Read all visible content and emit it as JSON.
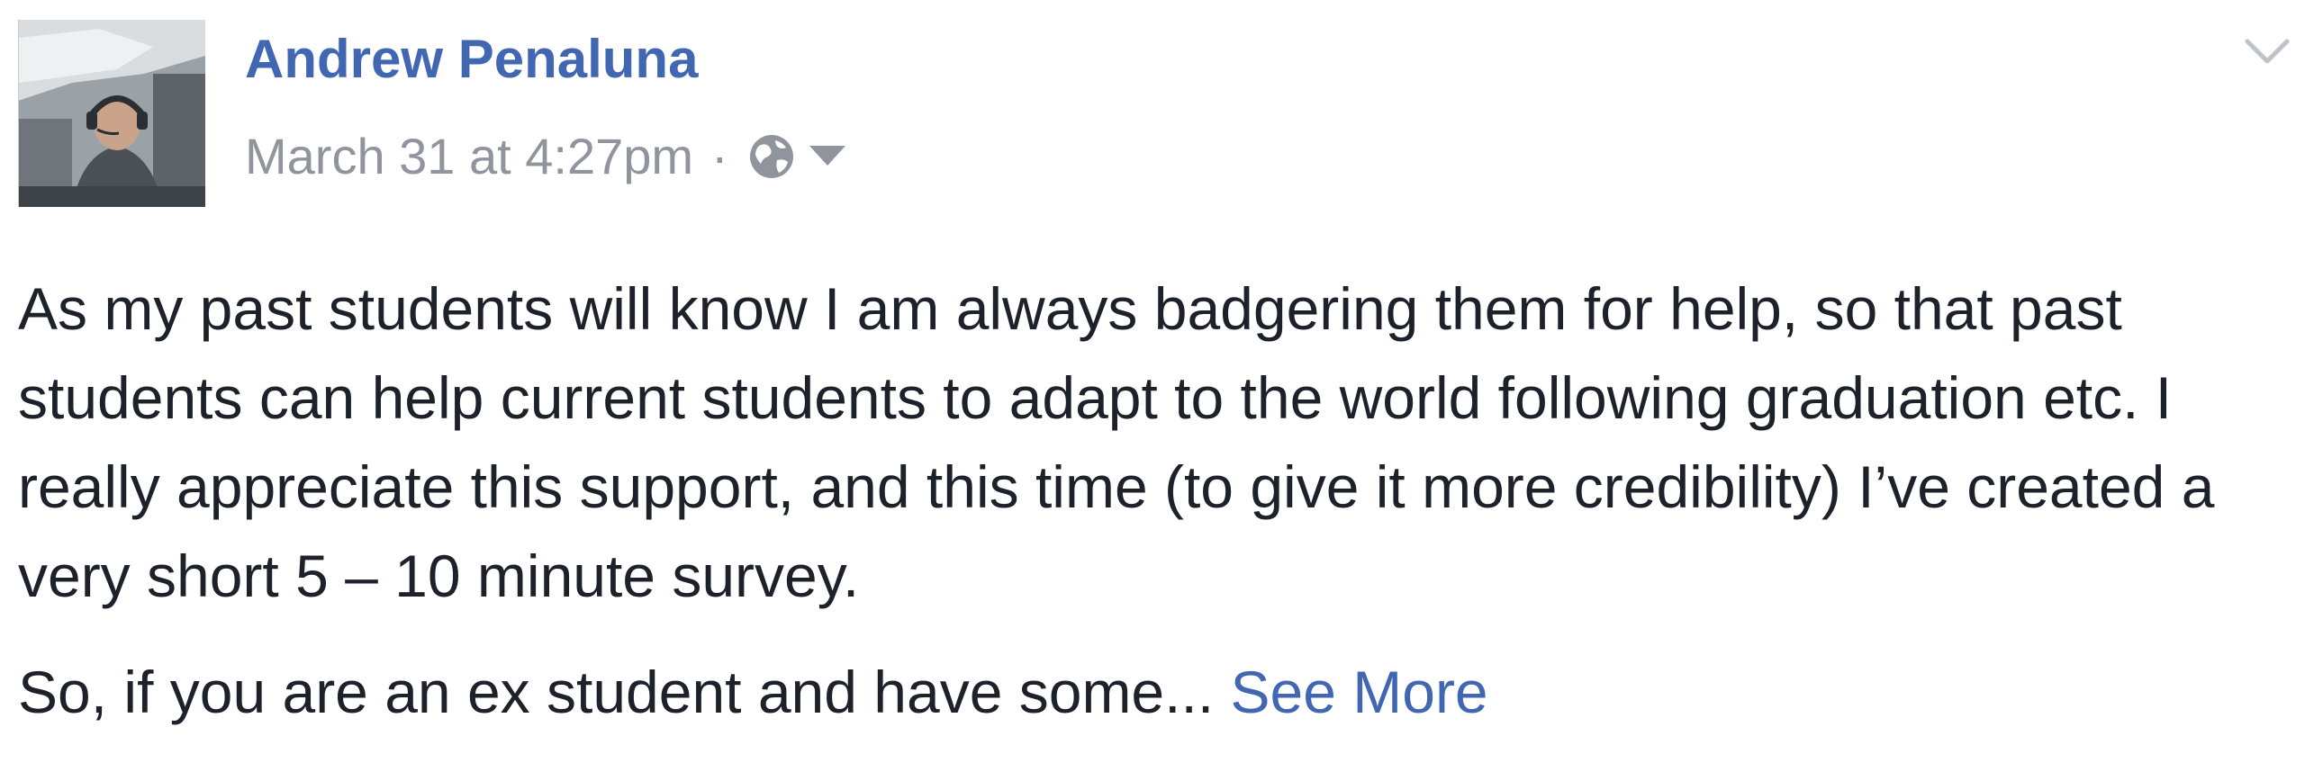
{
  "post": {
    "author_name": "Andrew Penaluna",
    "timestamp": "March 31 at 4:27pm",
    "separator": "·",
    "privacy_icon": "globe-icon",
    "menu_icon": "chevron-down-icon",
    "paragraphs": [
      "As my past students will know I am always badgering them for help, so that past students can help current students to adapt to the world following graduation etc. I really appreciate this support, and this time (to give it more credibility) I’ve created a very short 5 – 10 minute survey.",
      "So, if you are an ex student and have some... "
    ],
    "see_more_label": "See More"
  },
  "colors": {
    "link": "#4267b2",
    "meta": "#90949c",
    "text": "#1d2129"
  }
}
